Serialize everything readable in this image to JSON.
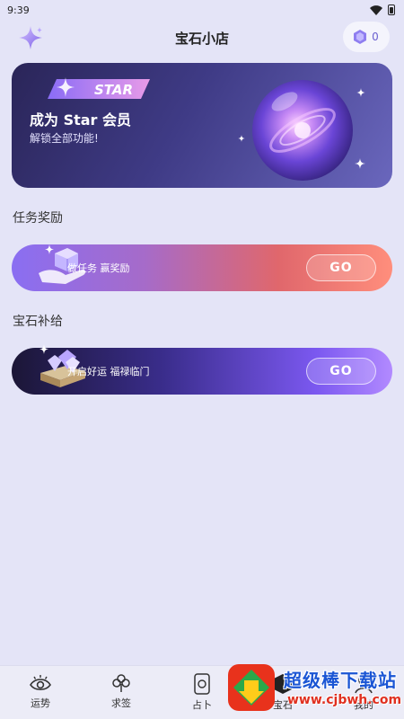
{
  "status_bar": {
    "time": "9:39"
  },
  "header": {
    "title": "宝石小店",
    "gem_count": "0"
  },
  "star_banner": {
    "badge": "STAR",
    "title": "成为 Star 会员",
    "subtitle": "解锁全部功能!"
  },
  "sections": {
    "tasks_title": "任务奖励",
    "supply_title": "宝石补给"
  },
  "task_card": {
    "text": "做任务 赢奖励",
    "button": "GO"
  },
  "supply_card": {
    "text": "开启好运 福禄临门",
    "button": "GO"
  },
  "bottom_nav": {
    "items": [
      {
        "label": "运势",
        "icon": "eye-icon"
      },
      {
        "label": "求签",
        "icon": "clover-icon"
      },
      {
        "label": "占卜",
        "icon": "tarot-card-icon"
      },
      {
        "label": "宝石",
        "icon": "gem-icon"
      },
      {
        "label": "我的",
        "icon": "profile-icon"
      }
    ]
  },
  "watermark": {
    "text": "超级棒下载站",
    "url": "www.cjbwh.com"
  },
  "colors": {
    "background": "#e4e4f7",
    "accent": "#6a5fcf",
    "reward_gradient_end": "#ff8e7c",
    "supply_gradient_end": "#b28aff"
  }
}
